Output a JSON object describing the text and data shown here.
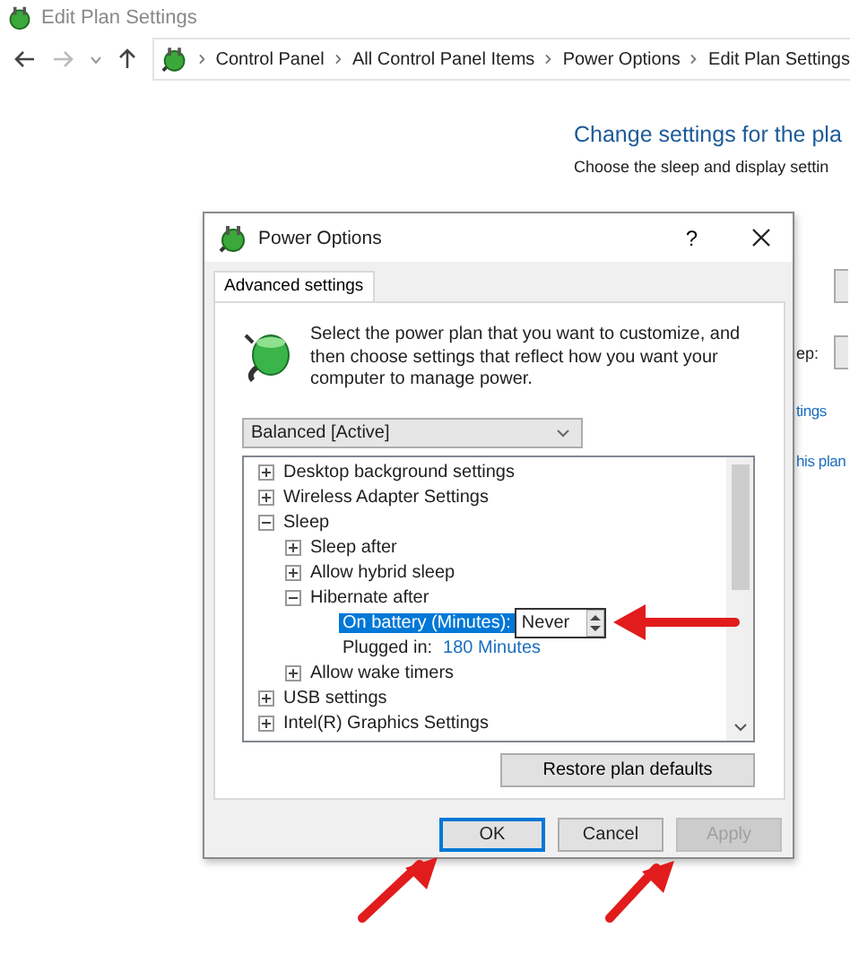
{
  "window": {
    "title": "Edit Plan Settings"
  },
  "address_bar": {
    "breadcrumbs": [
      "Control Panel",
      "All Control Panel Items",
      "Power Options",
      "Edit Plan Settings"
    ]
  },
  "page": {
    "heading": "Change settings for the pla",
    "subheading": "Choose the sleep and display settin",
    "label_1": "ep:",
    "link_1": "tings",
    "link_2": "his plan"
  },
  "dialog": {
    "title": "Power Options",
    "help": "?",
    "tabs": [
      {
        "label": "Advanced settings",
        "selected": true
      }
    ],
    "intro": "Select the power plan that you want to customize, and then choose settings that reflect how you want your computer to manage power.",
    "plan_dropdown": "Balanced [Active]",
    "tree": [
      {
        "kind": "group",
        "label": "Desktop background settings",
        "expanded": false
      },
      {
        "kind": "group",
        "label": "Wireless Adapter Settings",
        "expanded": false
      },
      {
        "kind": "group",
        "label": "Sleep",
        "expanded": true,
        "children": [
          {
            "kind": "group",
            "label": "Sleep after",
            "expanded": false
          },
          {
            "kind": "group",
            "label": "Allow hybrid sleep",
            "expanded": false
          },
          {
            "kind": "group",
            "label": "Hibernate after",
            "expanded": true,
            "children": [
              {
                "kind": "setting",
                "label": "On battery (Minutes):",
                "value": "Never",
                "selected": true
              },
              {
                "kind": "setting",
                "label": "Plugged in:",
                "value": "180 Minutes",
                "selected": false
              }
            ]
          },
          {
            "kind": "group",
            "label": "Allow wake timers",
            "expanded": false
          }
        ]
      },
      {
        "kind": "group",
        "label": "USB settings",
        "expanded": false
      },
      {
        "kind": "group",
        "label": "Intel(R) Graphics Settings",
        "expanded": false
      }
    ],
    "restore_button": "Restore plan defaults",
    "buttons": [
      {
        "label": "OK",
        "default": true,
        "disabled": false
      },
      {
        "label": "Cancel",
        "default": false,
        "disabled": false
      },
      {
        "label": "Apply",
        "default": false,
        "disabled": true
      }
    ]
  }
}
